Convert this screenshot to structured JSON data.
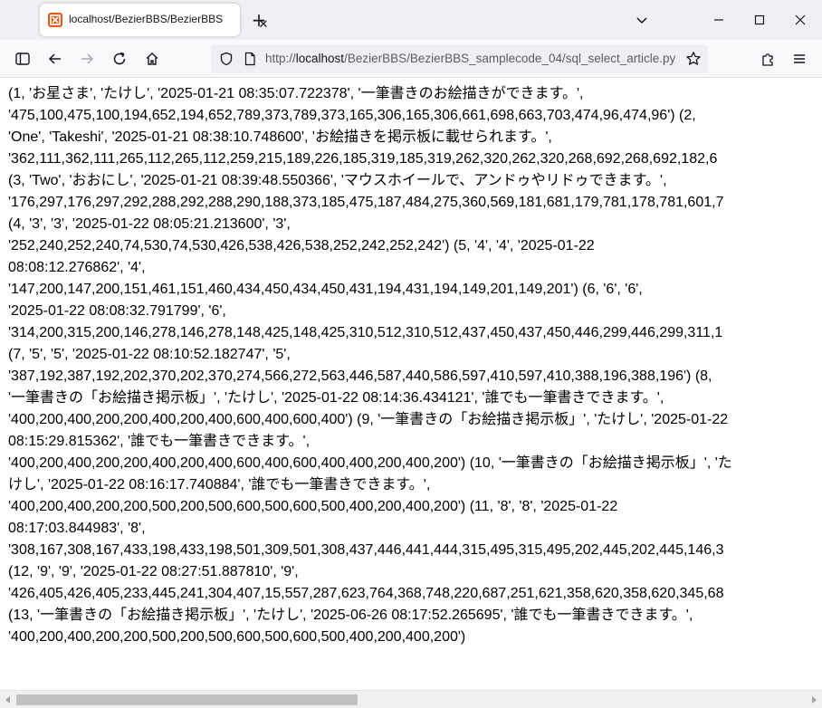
{
  "browser": {
    "tab": {
      "title": "localhost/BezierBBS/BezierBBS_",
      "close_glyph": "✕"
    },
    "new_tab_glyph": "+",
    "url": {
      "scheme": "http://",
      "host": "localhost",
      "path": "/BezierBBS/BezierBBS_samplecode_04/sql_select_article.py"
    }
  },
  "page": {
    "lines": [
      "(1, 'お星さま', 'たけし', '2025-01-21 08:35:07.722378', '一筆書きのお絵描きができます。',",
      "'475,100,475,100,194,652,194,652,789,373,789,373,165,306,165,306,661,698,663,703,474,96,474,96') (2,",
      "'One', 'Takeshi', '2025-01-21 08:38:10.748600', 'お絵描きを掲示板に載せられます。',",
      "'362,111,362,111,265,112,265,112,259,215,189,226,185,319,185,319,262,320,262,320,268,692,268,692,182,6",
      "(3, 'Two', 'おおにし', '2025-01-21 08:39:48.550366', 'マウスホイールで、アンドゥやリドゥできます。',",
      "'176,297,176,297,292,288,292,288,290,188,373,185,475,187,484,275,360,569,181,681,179,781,178,781,601,7",
      "(4, '3', '3', '2025-01-22 08:05:21.213600', '3',",
      "'252,240,252,240,74,530,74,530,426,538,426,538,252,242,252,242') (5, '4', '4', '2025-01-22",
      "08:08:12.276862', '4',",
      "'147,200,147,200,151,461,151,460,434,450,434,450,431,194,431,194,149,201,149,201') (6, '6', '6',",
      "'2025-01-22 08:08:32.791799', '6',",
      "'314,200,315,200,146,278,146,278,148,425,148,425,310,512,310,512,437,450,437,450,446,299,446,299,311,1",
      "(7, '5', '5', '2025-01-22 08:10:52.182747', '5',",
      "'387,192,387,192,202,370,202,370,274,566,272,563,446,587,440,586,597,410,597,410,388,196,388,196') (8,",
      "'一筆書きの「お絵描き掲示板」', 'たけし', '2025-01-22 08:14:36.434121', '誰でも一筆書きできます。',",
      "'400,200,400,200,200,400,200,400,600,400,600,400') (9, '一筆書きの「お絵描き掲示板」', 'たけし', '2025-01-22",
      "08:15:29.815362', '誰でも一筆書きできます。',",
      "'400,200,400,200,200,400,200,400,600,400,600,400,400,200,400,200') (10, '一筆書きの「お絵描き掲示板」', 'た",
      "けし', '2025-01-22 08:16:17.740884', '誰でも一筆書きできます。',",
      "'400,200,400,200,200,500,200,500,600,500,600,500,400,200,400,200') (11, '8', '8', '2025-01-22",
      "08:17:03.844983', '8',",
      "'308,167,308,167,433,198,433,198,501,309,501,308,437,446,441,444,315,495,315,495,202,445,202,445,146,3",
      "(12, '9', '9', '2025-01-22 08:27:51.887810', '9',",
      "'426,405,426,405,233,445,241,304,407,15,557,287,623,764,368,748,220,687,251,621,358,620,358,620,345,68",
      "(13, '一筆書きの「お絵描き掲示板」', 'たけし', '2025-06-26 08:17:52.265695', '誰でも一筆書きできます。',",
      "'400,200,400,200,200,500,200,500,600,500,600,500,400,200,400,200')"
    ]
  },
  "scrollbar": {
    "horizontal_position": 0.0
  },
  "colors": {
    "tab_strip": "#f0f0f4",
    "toolbar": "#f9f9fb",
    "urlbar": "#f0f0f4",
    "favicon": "#e25b1e",
    "text": "#000000"
  },
  "icons": [
    "favicon-icon",
    "tab-close-icon",
    "new-tab-icon",
    "list-all-tabs-icon",
    "window-minimize-icon",
    "window-maximize-icon",
    "window-close-icon",
    "sidebar-icon",
    "back-arrow-icon",
    "forward-arrow-icon",
    "reload-icon",
    "home-icon",
    "shield-icon",
    "page-icon",
    "bookmark-star-icon",
    "extensions-icon",
    "menu-icon"
  ]
}
